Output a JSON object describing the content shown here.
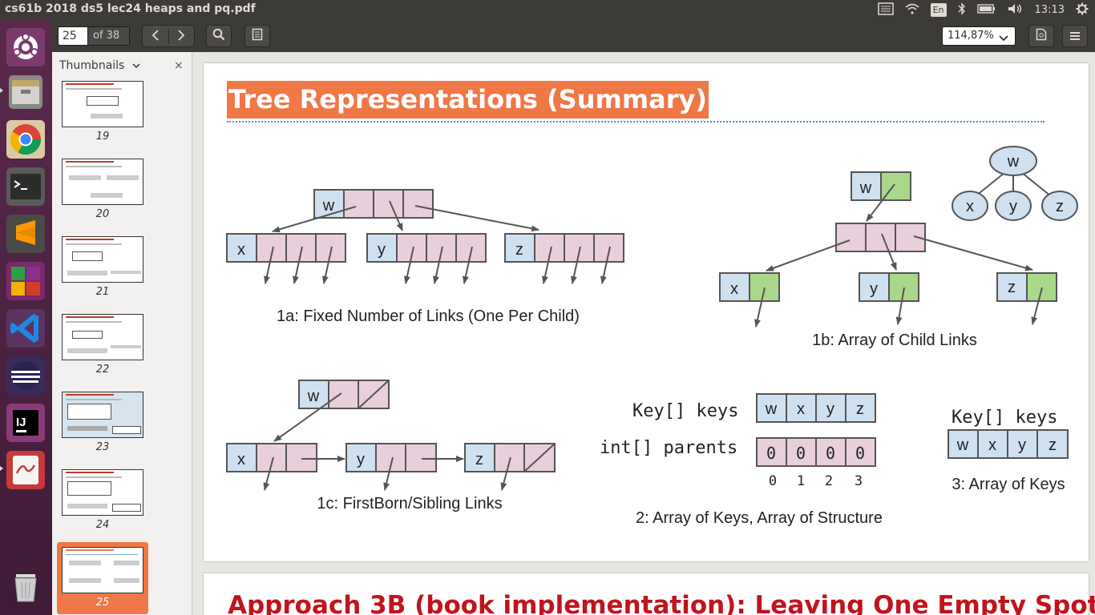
{
  "window": {
    "title": "cs61b 2018 ds5 lec24 heaps and pq.pdf"
  },
  "tray": {
    "keyboard": "En",
    "clock": "13:13"
  },
  "launcher": {
    "items": [
      "ubuntu-dash-icon",
      "files-icon",
      "chrome-icon",
      "terminal-icon",
      "sublime-text-icon",
      "libreoffice-icon",
      "vscode-icon",
      "eclipse-icon",
      "intellij-icon",
      "document-viewer-icon",
      "trash-icon"
    ]
  },
  "toolbar": {
    "page_current": "25",
    "page_total": "of 38",
    "zoom": "114,87%"
  },
  "sidebar": {
    "title": "Thumbnails",
    "thumbs": [
      {
        "num": "19"
      },
      {
        "num": "20"
      },
      {
        "num": "21"
      },
      {
        "num": "22"
      },
      {
        "num": "23"
      },
      {
        "num": "24"
      },
      {
        "num": "25"
      }
    ]
  },
  "slide": {
    "title": "Tree Representations (Summary)",
    "captions": {
      "c1a": "1a: Fixed Number of Links (One Per Child)",
      "c1b": "1b: Array of Child Links",
      "c1c": "1c: FirstBorn/Sibling Links",
      "c2": "2: Array of Keys, Array of Structure",
      "c3": "3: Array of Keys"
    },
    "code": {
      "keys_label": "Key[] keys",
      "parents_label": "int[] parents",
      "keys_label_3": "Key[] keys"
    },
    "node_labels": {
      "w": "w",
      "x": "x",
      "y": "y",
      "z": "z"
    },
    "keys_values": [
      "w",
      "x",
      "y",
      "z"
    ],
    "parents_values": [
      "0",
      "0",
      "0",
      "0"
    ],
    "index_values": [
      "0",
      "1",
      "2",
      "3"
    ]
  },
  "next_slide": {
    "title": "Approach 3B (book implementation): Leaving One Empty Spot"
  },
  "colors": {
    "accent": "#f07746",
    "pink": "#e9cfdc",
    "blue": "#cfe0f1",
    "green": "#a9d88a",
    "next_title": "#c0141c"
  }
}
